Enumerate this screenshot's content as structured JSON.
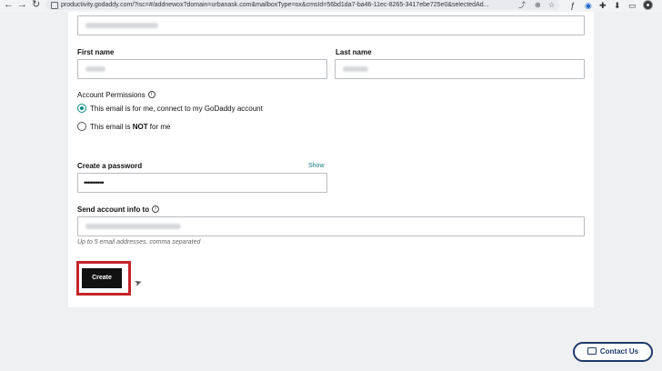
{
  "browser": {
    "url": "productivity.godaddy.com/?isc=#/addnewox?domain=urbanask.com&mailboxType=ox&cmsId=56bd1da7-ba46-11ec-8265-3417ebe725e0&selectedAd...",
    "nav": {
      "back": "←",
      "forward": "→",
      "reload": "↻"
    }
  },
  "form": {
    "email_value": "",
    "first_name_label": "First name",
    "first_name_value": "",
    "last_name_label": "Last name",
    "last_name_value": "",
    "permissions_label": "Account Permissions",
    "option_for_me": "This email is for me, connect to my GoDaddy account",
    "option_not_for_me_prefix": "This email is ",
    "option_not_for_me_strong": "NOT",
    "option_not_for_me_suffix": " for me",
    "password_label": "Create a password",
    "show_label": "Show",
    "password_value": "••••••••••",
    "send_info_label": "Send account info to",
    "send_info_value": "",
    "send_info_hint": "Up to 5 email addresses, comma separated",
    "create_button": "Create"
  },
  "support": {
    "contact_label": "Contact Us"
  },
  "colors": {
    "accent": "#0a8a85",
    "highlight": "#c4242b",
    "contact": "#1e3a68"
  }
}
